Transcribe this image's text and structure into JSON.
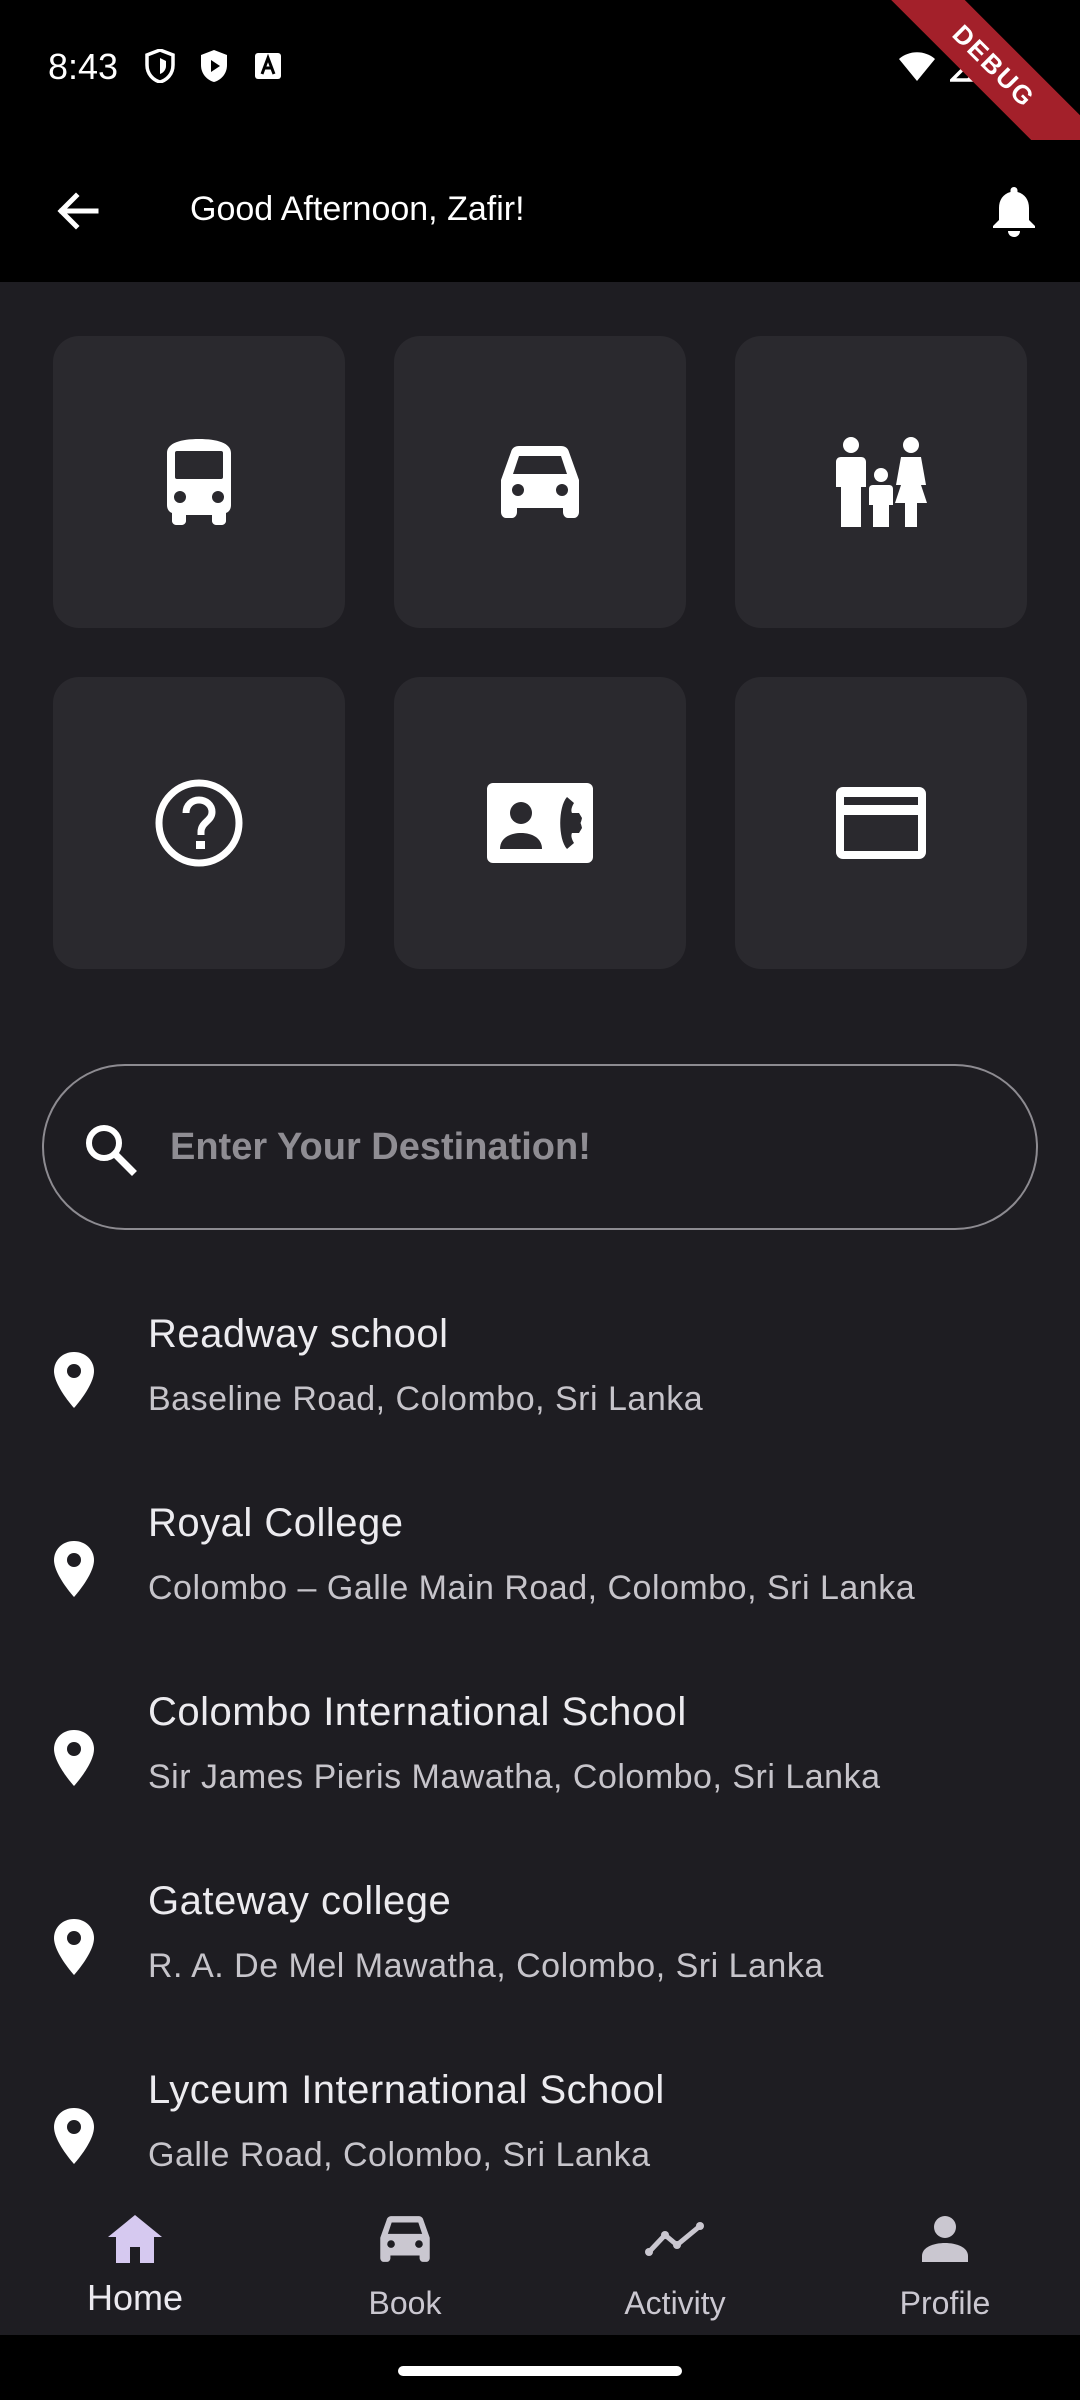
{
  "status_bar": {
    "time": "8:43",
    "debug_label": "DEBUG"
  },
  "app_bar": {
    "title": "Good Afternoon, Zafir!"
  },
  "quick_actions": [
    {
      "icon": "bus-icon"
    },
    {
      "icon": "car-icon"
    },
    {
      "icon": "family-icon"
    },
    {
      "icon": "help-icon"
    },
    {
      "icon": "contact-phone-icon"
    },
    {
      "icon": "credit-card-icon"
    }
  ],
  "search": {
    "placeholder": "Enter Your Destination!"
  },
  "places": [
    {
      "name": "Readway school",
      "address": "Baseline Road, Colombo, Sri Lanka"
    },
    {
      "name": "Royal College",
      "address": "Colombo – Galle Main Road, Colombo, Sri Lanka"
    },
    {
      "name": "Colombo International School",
      "address": "Sir James Pieris Mawatha, Colombo, Sri Lanka"
    },
    {
      "name": "Gateway college",
      "address": "R. A. De Mel Mawatha, Colombo, Sri Lanka"
    },
    {
      "name": "Lyceum International School",
      "address": "Galle Road, Colombo, Sri Lanka"
    }
  ],
  "bottom_nav": {
    "items": [
      {
        "label": "Home",
        "icon": "home-icon",
        "active": true
      },
      {
        "label": "Book",
        "icon": "car-icon",
        "active": false
      },
      {
        "label": "Activity",
        "icon": "activity-icon",
        "active": false
      },
      {
        "label": "Profile",
        "icon": "profile-icon",
        "active": false
      }
    ]
  },
  "colors": {
    "background": "#1e1d22",
    "tile": "#2a292e",
    "app_bar": "#000000",
    "debug_ribbon": "#a3202a",
    "nav_active_icon": "#d6c9f0"
  }
}
